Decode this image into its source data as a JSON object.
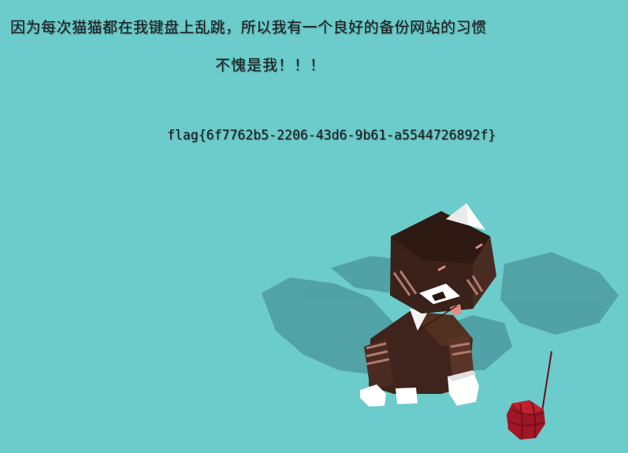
{
  "page": {
    "background_color": "#6ccbcb",
    "intro_text": "因为每次猫猫都在我键盘上乱跳，所以我有一个良好的备份网站的习惯",
    "not_me_text": "不愧是我！！！",
    "flag_text": "flag{6f7762b5-2206-43d6-9b61-a5544726892f}"
  },
  "scene": {
    "cat_color": "#4a2b22",
    "yarn_color": "#a01624",
    "shadow_color": "#4c9ca0"
  }
}
